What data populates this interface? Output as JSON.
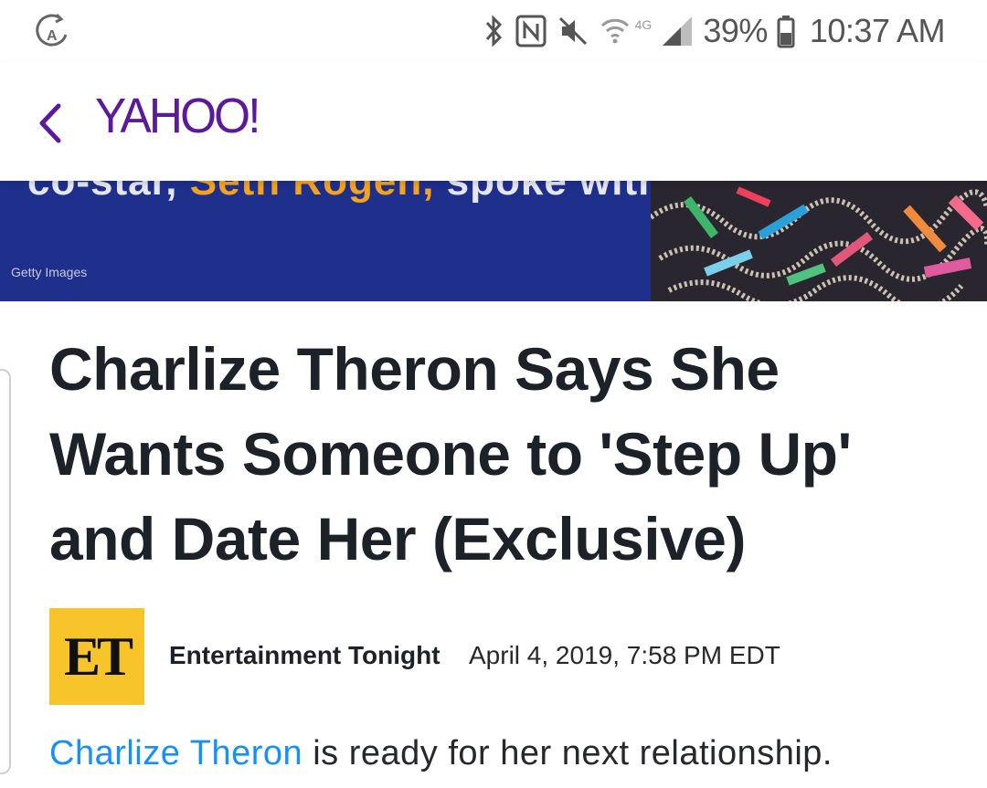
{
  "status_bar": {
    "battery": "39%",
    "time": "10:37 AM",
    "network": "4G",
    "icons": [
      "auto-rotate-icon",
      "bluetooth-icon",
      "nfc-icon",
      "mute-icon",
      "wifi-icon",
      "signal-icon",
      "battery-icon"
    ]
  },
  "header": {
    "back_icon": "chevron-left-icon",
    "logo": "YAHOO!",
    "brand_color": "#5a1a9a"
  },
  "hero": {
    "caption_start": "co-star, ",
    "caption_highlight": "Seth Rogen,",
    "caption_end": " spoke with...",
    "credit": "Getty Images"
  },
  "article": {
    "headline": "Charlize Theron Says She Wants Someone to 'Step Up' and Date Her (Exclusive)",
    "source_logo": "ET",
    "source_name": "Entertainment Tonight",
    "date": "April 4, 2019, 7:58 PM EDT",
    "lead_link": "Charlize Theron",
    "lead_text": " is ready for her next relationship.",
    "link_color": "#188fff"
  }
}
